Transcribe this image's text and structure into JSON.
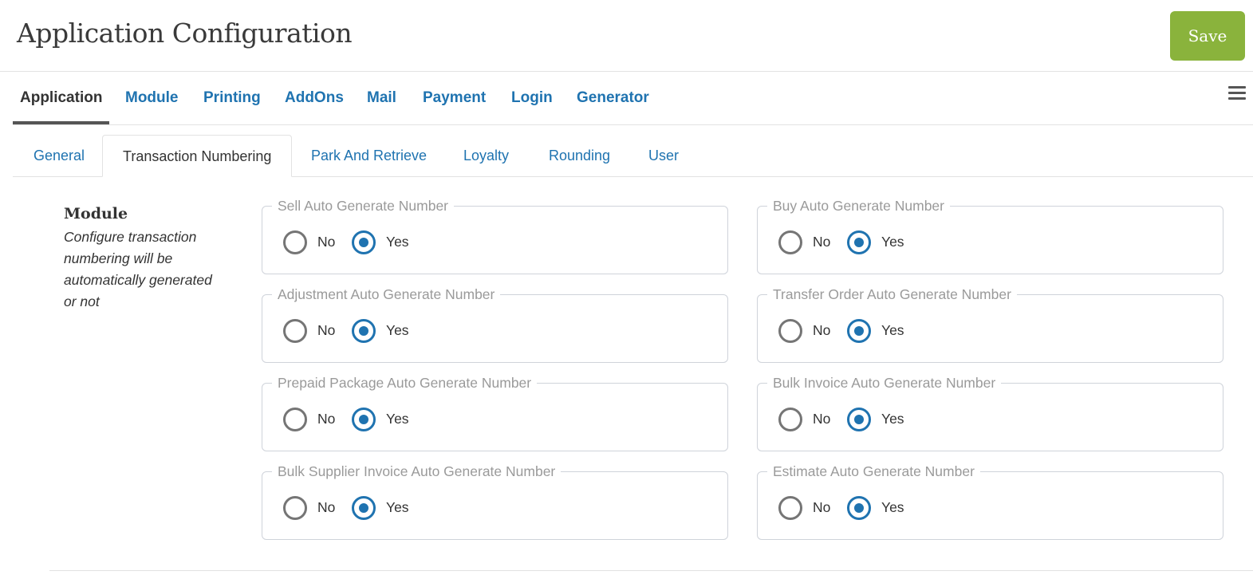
{
  "header": {
    "title": "Application Configuration",
    "save_label": "Save"
  },
  "main_tabs": [
    {
      "label": "Application",
      "active": true
    },
    {
      "label": "Module",
      "active": false
    },
    {
      "label": "Printing",
      "active": false
    },
    {
      "label": "AddOns",
      "active": false
    },
    {
      "label": "Mail",
      "active": false
    },
    {
      "label": "Payment",
      "active": false
    },
    {
      "label": "Login",
      "active": false
    },
    {
      "label": "Generator",
      "active": false
    }
  ],
  "menu_icon": "hamburger-menu-icon",
  "sub_tabs": [
    {
      "label": "General",
      "active": false
    },
    {
      "label": "Transaction Numbering",
      "active": true
    },
    {
      "label": "Park And Retrieve",
      "active": false
    },
    {
      "label": "Loyalty",
      "active": false
    },
    {
      "label": "Rounding",
      "active": false
    },
    {
      "label": "User",
      "active": false
    }
  ],
  "section": {
    "title": "Module",
    "description": "Configure transaction numbering will be automatically generated or not"
  },
  "options": {
    "no": "No",
    "yes": "Yes"
  },
  "settings": [
    {
      "label": "Sell Auto Generate Number",
      "value": "Yes"
    },
    {
      "label": "Buy Auto Generate Number",
      "value": "Yes"
    },
    {
      "label": "Adjustment Auto Generate Number",
      "value": "Yes"
    },
    {
      "label": "Transfer Order Auto Generate Number",
      "value": "Yes"
    },
    {
      "label": "Prepaid Package Auto Generate Number",
      "value": "Yes"
    },
    {
      "label": "Bulk Invoice Auto Generate Number",
      "value": "Yes"
    },
    {
      "label": "Bulk Supplier Invoice Auto Generate Number",
      "value": "Yes"
    },
    {
      "label": "Estimate Auto Generate Number",
      "value": "Yes"
    }
  ],
  "colors": {
    "accent": "#1f73b0",
    "save": "#8ab33c"
  }
}
